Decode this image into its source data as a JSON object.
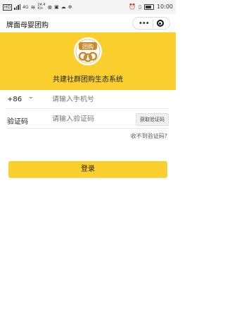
{
  "status": {
    "left_text": "HD",
    "network": "4G",
    "speed": "24.4\nK/s",
    "time": "10:00"
  },
  "nav": {
    "title": "牌面母婴团购",
    "more_glyph": "•••"
  },
  "logo": {
    "text": "团购"
  },
  "slogan": "共建社群团购生态系统",
  "phone_row": {
    "country_code": "+86",
    "chevron": "⌄",
    "placeholder": "请输入手机号"
  },
  "code_row": {
    "label": "验证码",
    "placeholder": "请输入验证码",
    "get_code": "获取验证码"
  },
  "no_code_link": "收不到验证码?",
  "login_button": "登录",
  "colors": {
    "brand": "#fbcf2d",
    "logo_brown": "#c98a2e"
  }
}
